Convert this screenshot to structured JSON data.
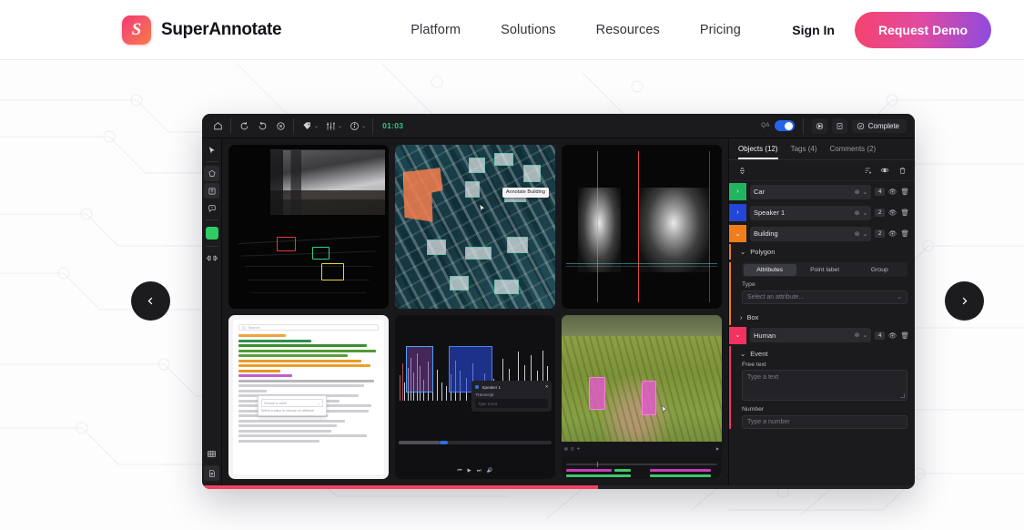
{
  "nav": {
    "brand": "SuperAnnotate",
    "logo_glyph": "S",
    "links": [
      "Platform",
      "Solutions",
      "Resources",
      "Pricing"
    ],
    "signin": "Sign In",
    "cta": "Request Demo",
    "cta_gradient_from": "#f5436e",
    "cta_gradient_to": "#8c4be0"
  },
  "carousel": {
    "prev": "‹",
    "next": "›"
  },
  "app": {
    "toolbar": {
      "timer": "01:03",
      "qa_label": "QA",
      "qa_on": true,
      "complete_label": "Complete",
      "caret": "⌄"
    },
    "tools": {
      "swatch_color": "#2ecc62"
    },
    "panels": {
      "satellite_tooltip": "Annotate Building",
      "audio_popup": {
        "title": "Speaker 1",
        "field_label": "Transcript",
        "placeholder": "Type a text"
      },
      "doc_search_placeholder": "Search",
      "doc_dropdown_value": "Choose a value",
      "doc_dropdown_hint": "Select a value to choose an attribute"
    },
    "right_panel": {
      "tabs": [
        {
          "label": "Objects (12)",
          "active": true
        },
        {
          "label": "Tags (4)",
          "active": false
        },
        {
          "label": "Comments (2)",
          "active": false
        }
      ],
      "objects": [
        {
          "name": "Car",
          "color": "#22b45e",
          "count": "4",
          "expanded": false
        },
        {
          "name": "Speaker 1",
          "color": "#2346d8",
          "count": "2",
          "expanded": false
        },
        {
          "name": "Building",
          "color": "#ef7d1c",
          "count": "2",
          "expanded": true
        }
      ],
      "building_detail": {
        "section": "Polygon",
        "segments": [
          {
            "label": "Attributes",
            "active": true
          },
          {
            "label": "Point label",
            "active": false
          },
          {
            "label": "Group",
            "active": false
          }
        ],
        "type_label": "Type",
        "type_placeholder": "Select an attribute...",
        "box_section": "Box"
      },
      "human": {
        "name": "Human",
        "color": "#f4325f",
        "count": "4",
        "expanded": true
      },
      "human_detail": {
        "section": "Event",
        "freetext_label": "Free text",
        "freetext_placeholder": "Type a text",
        "number_label": "Number",
        "number_placeholder": "Type a number"
      }
    }
  }
}
